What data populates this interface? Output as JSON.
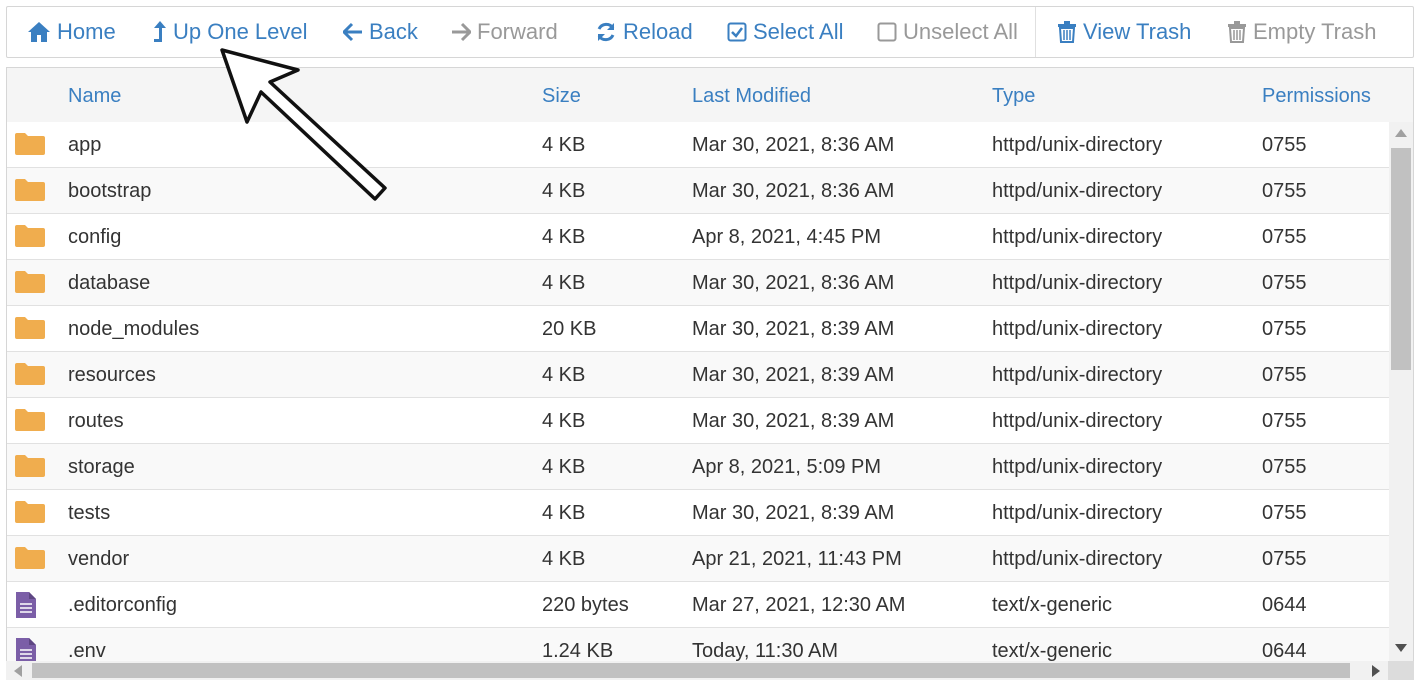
{
  "toolbar": {
    "home": "Home",
    "up_one_level": "Up One Level",
    "back": "Back",
    "forward": "Forward",
    "reload": "Reload",
    "select_all": "Select All",
    "unselect_all": "Unselect All",
    "view_trash": "View Trash",
    "empty_trash": "Empty Trash"
  },
  "columns": {
    "name": "Name",
    "size": "Size",
    "last_modified": "Last Modified",
    "type": "Type",
    "permissions": "Permissions"
  },
  "files": [
    {
      "icon": "folder-icon",
      "name": "app",
      "size": "4 KB",
      "modified": "Mar 30, 2021, 8:36 AM",
      "type": "httpd/unix-directory",
      "perms": "0755"
    },
    {
      "icon": "folder-icon",
      "name": "bootstrap",
      "size": "4 KB",
      "modified": "Mar 30, 2021, 8:36 AM",
      "type": "httpd/unix-directory",
      "perms": "0755"
    },
    {
      "icon": "folder-icon",
      "name": "config",
      "size": "4 KB",
      "modified": "Apr 8, 2021, 4:45 PM",
      "type": "httpd/unix-directory",
      "perms": "0755"
    },
    {
      "icon": "folder-icon",
      "name": "database",
      "size": "4 KB",
      "modified": "Mar 30, 2021, 8:36 AM",
      "type": "httpd/unix-directory",
      "perms": "0755"
    },
    {
      "icon": "folder-icon",
      "name": "node_modules",
      "size": "20 KB",
      "modified": "Mar 30, 2021, 8:39 AM",
      "type": "httpd/unix-directory",
      "perms": "0755"
    },
    {
      "icon": "folder-icon",
      "name": "resources",
      "size": "4 KB",
      "modified": "Mar 30, 2021, 8:39 AM",
      "type": "httpd/unix-directory",
      "perms": "0755"
    },
    {
      "icon": "folder-icon",
      "name": "routes",
      "size": "4 KB",
      "modified": "Mar 30, 2021, 8:39 AM",
      "type": "httpd/unix-directory",
      "perms": "0755"
    },
    {
      "icon": "folder-icon",
      "name": "storage",
      "size": "4 KB",
      "modified": "Apr 8, 2021, 5:09 PM",
      "type": "httpd/unix-directory",
      "perms": "0755"
    },
    {
      "icon": "folder-icon",
      "name": "tests",
      "size": "4 KB",
      "modified": "Mar 30, 2021, 8:39 AM",
      "type": "httpd/unix-directory",
      "perms": "0755"
    },
    {
      "icon": "folder-icon",
      "name": "vendor",
      "size": "4 KB",
      "modified": "Apr 21, 2021, 11:43 PM",
      "type": "httpd/unix-directory",
      "perms": "0755"
    },
    {
      "icon": "file-icon",
      "name": ".editorconfig",
      "size": "220 bytes",
      "modified": "Mar 27, 2021, 12:30 AM",
      "type": "text/x-generic",
      "perms": "0644"
    },
    {
      "icon": "file-icon",
      "name": ".env",
      "size": "1.24 KB",
      "modified": "Today, 11:30 AM",
      "type": "text/x-generic",
      "perms": "0644"
    }
  ],
  "colors": {
    "link": "#3a7fc1",
    "disabled": "#999999",
    "folder": "#f0ad4e",
    "file": "#7b5ea7"
  }
}
